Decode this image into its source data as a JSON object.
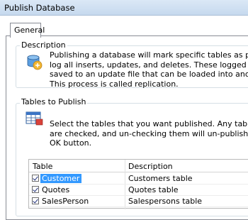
{
  "window": {
    "title": "Publish Database"
  },
  "tabs": [
    {
      "label": "General",
      "selected": true
    }
  ],
  "description_group": {
    "title": "Description",
    "icon": "database-publish-icon",
    "lines": [
      "Publishing a database will mark specific tables as published so that th",
      "log all inserts, updates, and deletes.  These logged operations can the",
      "saved to an update file that can be loaded into another database usir",
      "This process is called replication."
    ]
  },
  "tables_group": {
    "title": "Tables to Publish",
    "icon": "table-grid-icon",
    "lines": [
      "Select the tables that you want published.  Any tables that are already",
      "are checked, and un-checking them will un-publish them once you c",
      "OK button."
    ]
  },
  "table_grid": {
    "columns": [
      "Table",
      "Description"
    ],
    "rows": [
      {
        "name": "Customer",
        "description": "Customers table",
        "checked": true,
        "selected": true
      },
      {
        "name": "Quotes",
        "description": "Quotes table",
        "checked": true,
        "selected": false
      },
      {
        "name": "SalesPerson",
        "description": "Salespersons table",
        "checked": true,
        "selected": false
      }
    ]
  },
  "colors": {
    "selection": "#3399ff",
    "titlebar": "#c6d9ee",
    "border": "#898c95"
  }
}
